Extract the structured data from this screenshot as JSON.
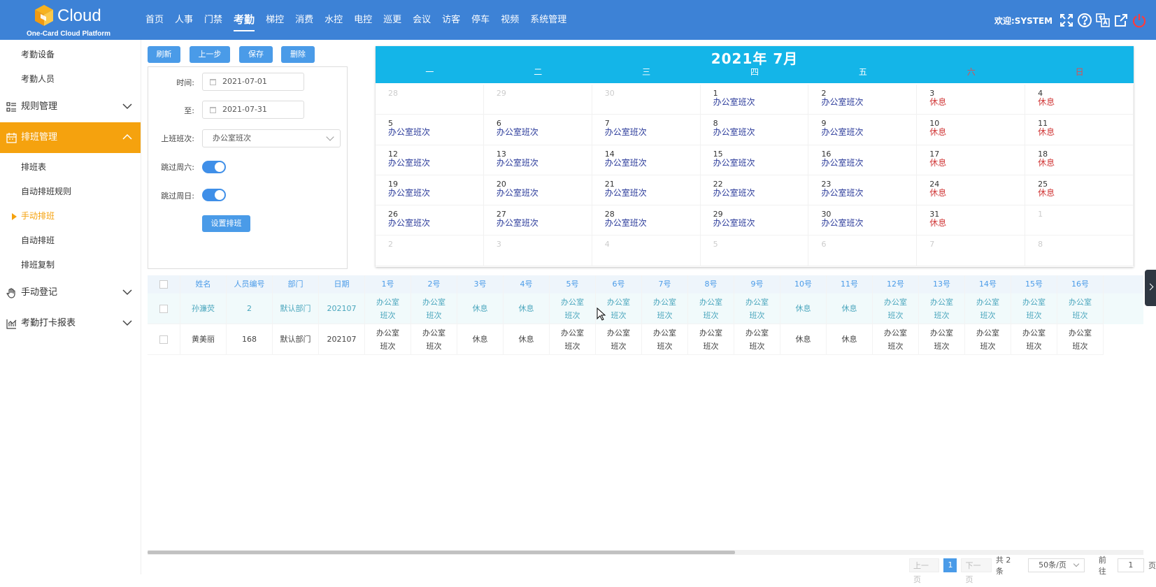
{
  "app": {
    "logo_word": "Cloud",
    "logo_tagline": "One-Card Cloud Platform",
    "welcome": "欢迎:SYSTEM",
    "colors": {
      "topbar": "#3d82d6",
      "accent": "#f5a20e",
      "calendar_header": "#14b5e8",
      "button": "#4a9be8",
      "rest": "#d13a3a"
    }
  },
  "nav": [
    "首页",
    "人事",
    "门禁",
    "考勤",
    "梯控",
    "消费",
    "水控",
    "电控",
    "巡更",
    "会议",
    "访客",
    "停车",
    "视频",
    "系统管理"
  ],
  "nav_active": "考勤",
  "top_icons": [
    "fullscreen-icon",
    "help-icon",
    "language-icon",
    "external-link-icon",
    "power-icon"
  ],
  "sidebar": {
    "top_items": [
      "考勤设备",
      "考勤人员"
    ],
    "groups": [
      {
        "label": "规则管理",
        "icon": "list-icon"
      },
      {
        "label": "排班管理",
        "icon": "calendar-icon"
      },
      {
        "label": "手动登记",
        "icon": "hand-icon"
      },
      {
        "label": "考勤打卡报表",
        "icon": "chart-icon"
      }
    ],
    "schedule_items": [
      "排班表",
      "自动排班规则",
      "手动排班",
      "自动排班",
      "排班复制"
    ],
    "active_item": "手动排班"
  },
  "toolbar": {
    "refresh": "刷新",
    "prev": "上一步",
    "save": "保存",
    "delete": "删除"
  },
  "form": {
    "time_label": "时间:",
    "start_date": "2021-07-01",
    "to_label": "至:",
    "end_date": "2021-07-31",
    "shift_label": "上班班次:",
    "shift_value": "办公室班次",
    "skip_sat_label": "跳过周六:",
    "skip_sat": true,
    "skip_sun_label": "跳过周日:",
    "skip_sun": true,
    "set_button": "设置排班"
  },
  "calendar": {
    "title": "2021年  7月",
    "weekdays": [
      "一",
      "二",
      "三",
      "四",
      "五",
      "六",
      "日"
    ],
    "weeks": [
      [
        {
          "d": "28",
          "s": "",
          "o": true
        },
        {
          "d": "29",
          "s": "",
          "o": true
        },
        {
          "d": "30",
          "s": "",
          "o": true
        },
        {
          "d": "1",
          "s": "办公室班次"
        },
        {
          "d": "2",
          "s": "办公室班次"
        },
        {
          "d": "3",
          "s": "休息",
          "r": true
        },
        {
          "d": "4",
          "s": "休息",
          "r": true
        }
      ],
      [
        {
          "d": "5",
          "s": "办公室班次"
        },
        {
          "d": "6",
          "s": "办公室班次"
        },
        {
          "d": "7",
          "s": "办公室班次"
        },
        {
          "d": "8",
          "s": "办公室班次"
        },
        {
          "d": "9",
          "s": "办公室班次"
        },
        {
          "d": "10",
          "s": "休息",
          "r": true
        },
        {
          "d": "11",
          "s": "休息",
          "r": true
        }
      ],
      [
        {
          "d": "12",
          "s": "办公室班次"
        },
        {
          "d": "13",
          "s": "办公室班次"
        },
        {
          "d": "14",
          "s": "办公室班次"
        },
        {
          "d": "15",
          "s": "办公室班次"
        },
        {
          "d": "16",
          "s": "办公室班次"
        },
        {
          "d": "17",
          "s": "休息",
          "r": true
        },
        {
          "d": "18",
          "s": "休息",
          "r": true
        }
      ],
      [
        {
          "d": "19",
          "s": "办公室班次"
        },
        {
          "d": "20",
          "s": "办公室班次"
        },
        {
          "d": "21",
          "s": "办公室班次"
        },
        {
          "d": "22",
          "s": "办公室班次"
        },
        {
          "d": "23",
          "s": "办公室班次"
        },
        {
          "d": "24",
          "s": "休息",
          "r": true
        },
        {
          "d": "25",
          "s": "休息",
          "r": true
        }
      ],
      [
        {
          "d": "26",
          "s": "办公室班次"
        },
        {
          "d": "27",
          "s": "办公室班次"
        },
        {
          "d": "28",
          "s": "办公室班次"
        },
        {
          "d": "29",
          "s": "办公室班次"
        },
        {
          "d": "30",
          "s": "办公室班次"
        },
        {
          "d": "31",
          "s": "休息",
          "r": true
        },
        {
          "d": "1",
          "s": "",
          "o": true
        }
      ],
      [
        {
          "d": "2",
          "s": "",
          "o": true
        },
        {
          "d": "3",
          "s": "",
          "o": true
        },
        {
          "d": "4",
          "s": "",
          "o": true
        },
        {
          "d": "5",
          "s": "",
          "o": true
        },
        {
          "d": "6",
          "s": "",
          "o": true
        },
        {
          "d": "7",
          "s": "",
          "o": true
        },
        {
          "d": "8",
          "s": "",
          "o": true
        }
      ]
    ]
  },
  "table": {
    "headers": [
      "姓名",
      "人员编号",
      "部门",
      "日期",
      "1号",
      "2号",
      "3号",
      "4号",
      "5号",
      "6号",
      "7号",
      "8号",
      "9号",
      "10号",
      "11号",
      "12号",
      "13号",
      "14号",
      "15号",
      "16号"
    ],
    "rows": [
      [
        "孙濂荧",
        "2",
        "默认部门",
        "202107",
        "办公室班次",
        "办公室班次",
        "休息",
        "休息",
        "办公室班次",
        "办公室班次",
        "办公室班次",
        "办公室班次",
        "办公室班次",
        "休息",
        "休息",
        "办公室班次",
        "办公室班次",
        "办公室班次",
        "办公室班次",
        "办公室班次"
      ],
      [
        "黄美丽",
        "168",
        "默认部门",
        "202107",
        "办公室班次",
        "办公室班次",
        "休息",
        "休息",
        "办公室班次",
        "办公室班次",
        "办公室班次",
        "办公室班次",
        "办公室班次",
        "休息",
        "休息",
        "办公室班次",
        "办公室班次",
        "办公室班次",
        "办公室班次",
        "办公室班次"
      ]
    ]
  },
  "pager": {
    "prev": "上一页",
    "current": "1",
    "next": "下一页",
    "total": "共 2 条",
    "page_size": "50条/页",
    "goto_label": "前往",
    "goto_value": "1",
    "page_suffix": "页"
  }
}
